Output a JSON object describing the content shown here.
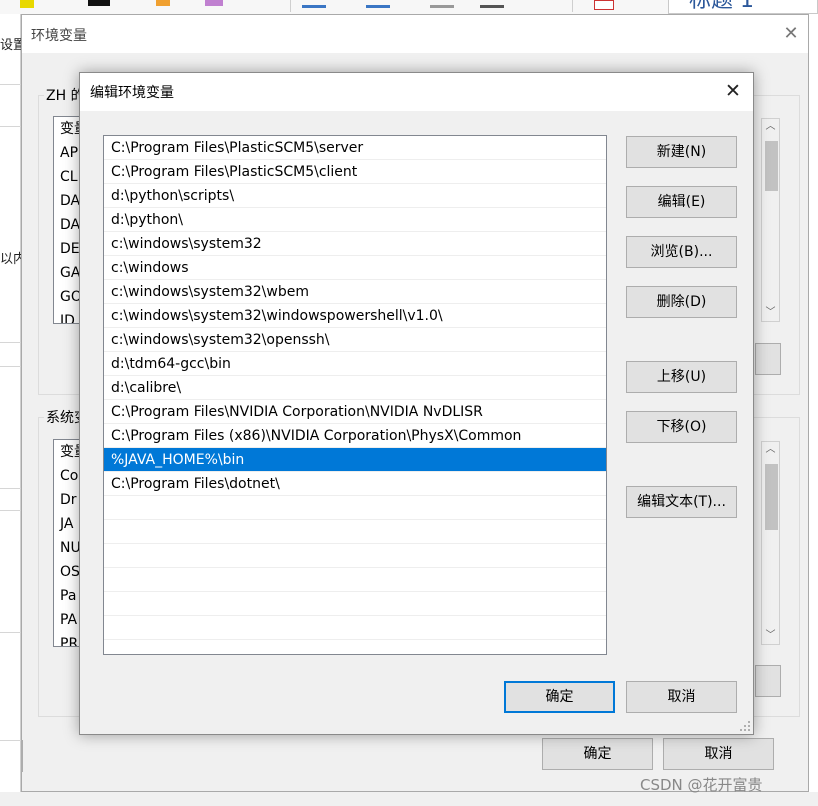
{
  "background": {
    "left_fragments": [
      "设置",
      "以内行"
    ],
    "title_style_text": "标题 1",
    "watermark": "CSDN @花开富贵"
  },
  "outer_dialog": {
    "title": "环境变量",
    "close_glyph": "✕",
    "user_group_label": "ZH 的",
    "user_list": {
      "header": "变量",
      "rows": [
        "AP",
        "CL",
        "DA",
        "DA",
        "DE",
        "GA",
        "GO",
        "ID"
      ]
    },
    "system_group_label": "系统变",
    "system_list": {
      "header": "变量",
      "rows": [
        "Co",
        "Dr",
        "JA",
        "NU",
        "OS",
        "Pa",
        "PA",
        "PR"
      ]
    },
    "ok_label": "确定",
    "cancel_label": "取消"
  },
  "inner_dialog": {
    "title": "编辑环境变量",
    "close_glyph": "✕",
    "paths": [
      "C:\\Program Files\\PlasticSCM5\\server",
      "C:\\Program Files\\PlasticSCM5\\client",
      "d:\\python\\scripts\\",
      "d:\\python\\",
      "c:\\windows\\system32",
      "c:\\windows",
      "c:\\windows\\system32\\wbem",
      "c:\\windows\\system32\\windowspowershell\\v1.0\\",
      "c:\\windows\\system32\\openssh\\",
      "d:\\tdm64-gcc\\bin",
      "d:\\calibre\\",
      "C:\\Program Files\\NVIDIA Corporation\\NVIDIA NvDLISR",
      "C:\\Program Files (x86)\\NVIDIA Corporation\\PhysX\\Common",
      "%JAVA_HOME%\\bin",
      "C:\\Program Files\\dotnet\\"
    ],
    "selected_index": 13,
    "buttons": {
      "new": "新建(N)",
      "edit": "编辑(E)",
      "browse": "浏览(B)...",
      "delete": "删除(D)",
      "move_up": "上移(U)",
      "move_down": "下移(O)",
      "edit_text": "编辑文本(T)..."
    },
    "ok_label": "确定",
    "cancel_label": "取消"
  }
}
